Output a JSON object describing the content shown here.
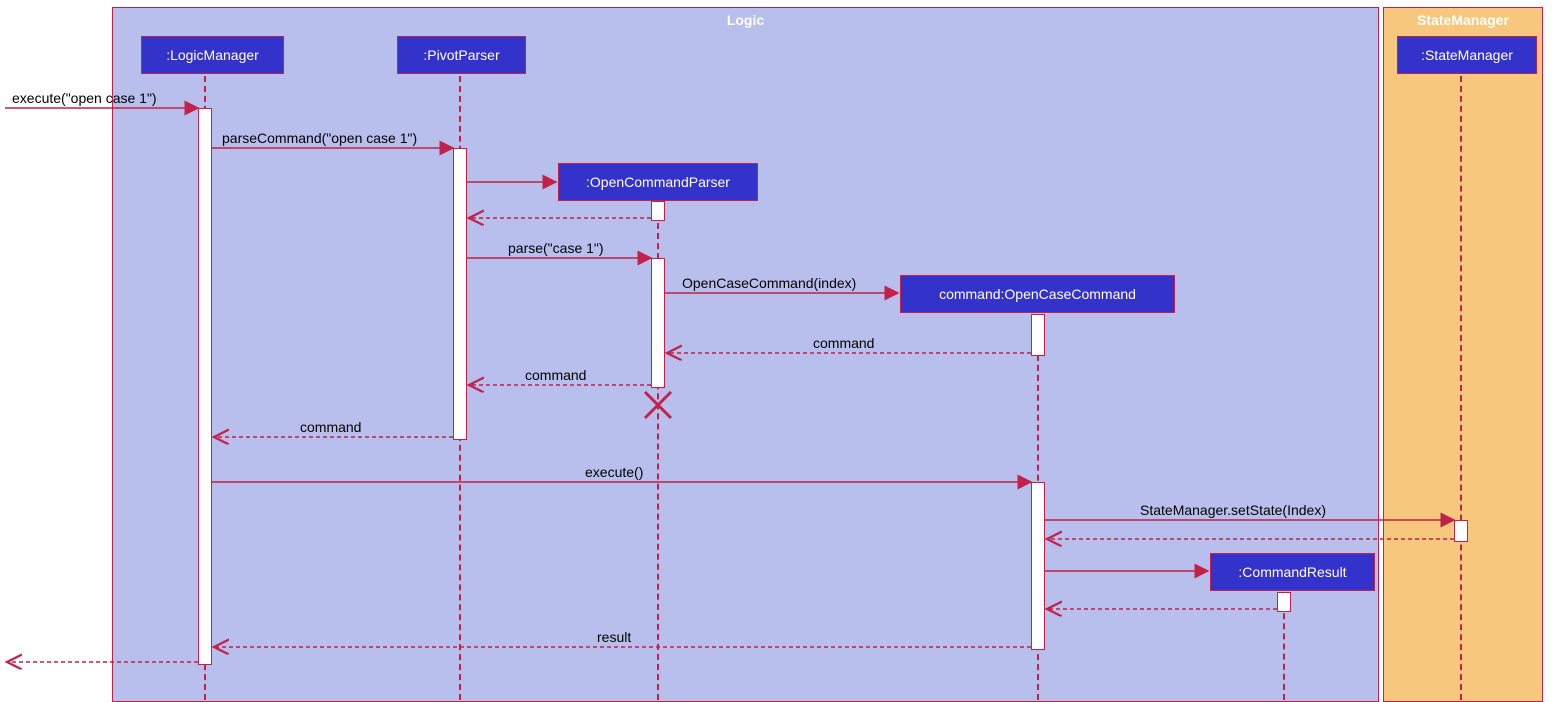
{
  "boxes": {
    "logic": "Logic",
    "state": "StateManager"
  },
  "participants": {
    "logicManager": ":LogicManager",
    "pivotParser": ":PivotParser",
    "openCommandParser": ":OpenCommandParser",
    "openCaseCommand": "command:OpenCaseCommand",
    "stateManager": ":StateManager",
    "commandResult": ":CommandResult"
  },
  "messages": {
    "m1": "execute(\"open case 1\")",
    "m2": "parseCommand(\"open case 1\")",
    "m3": "parse(\"case 1\")",
    "m4": "OpenCaseCommand(index)",
    "m5": "command",
    "m6": "command",
    "m7": "command",
    "m8": "execute()",
    "m9": "StateManager.setState(Index)",
    "m10": "result"
  },
  "diagram_data": {
    "type": "sequence",
    "boxes": [
      {
        "name": "Logic",
        "participants": [
          "LogicManager",
          "PivotParser",
          "OpenCommandParser",
          "OpenCaseCommand",
          "CommandResult"
        ]
      },
      {
        "name": "StateManager",
        "participants": [
          "StateManager"
        ]
      }
    ],
    "sequence": [
      {
        "from": "external",
        "to": "LogicManager",
        "msg": "execute(\"open case 1\")",
        "type": "call"
      },
      {
        "from": "LogicManager",
        "to": "PivotParser",
        "msg": "parseCommand(\"open case 1\")",
        "type": "call"
      },
      {
        "from": "PivotParser",
        "to": "OpenCommandParser",
        "msg": "create",
        "type": "create"
      },
      {
        "from": "OpenCommandParser",
        "to": "PivotParser",
        "msg": "",
        "type": "return"
      },
      {
        "from": "PivotParser",
        "to": "OpenCommandParser",
        "msg": "parse(\"case 1\")",
        "type": "call"
      },
      {
        "from": "OpenCommandParser",
        "to": "OpenCaseCommand",
        "msg": "OpenCaseCommand(index)",
        "type": "create"
      },
      {
        "from": "OpenCaseCommand",
        "to": "OpenCommandParser",
        "msg": "command",
        "type": "return"
      },
      {
        "from": "OpenCommandParser",
        "to": "PivotParser",
        "msg": "command",
        "type": "return"
      },
      {
        "from": "OpenCommandParser",
        "to": null,
        "msg": "",
        "type": "destroy"
      },
      {
        "from": "PivotParser",
        "to": "LogicManager",
        "msg": "command",
        "type": "return"
      },
      {
        "from": "LogicManager",
        "to": "OpenCaseCommand",
        "msg": "execute()",
        "type": "call"
      },
      {
        "from": "OpenCaseCommand",
        "to": "StateManager",
        "msg": "StateManager.setState(Index)",
        "type": "call"
      },
      {
        "from": "StateManager",
        "to": "OpenCaseCommand",
        "msg": "",
        "type": "return"
      },
      {
        "from": "OpenCaseCommand",
        "to": "CommandResult",
        "msg": "create",
        "type": "create"
      },
      {
        "from": "CommandResult",
        "to": "OpenCaseCommand",
        "msg": "",
        "type": "return"
      },
      {
        "from": "OpenCaseCommand",
        "to": "LogicManager",
        "msg": "result",
        "type": "return"
      },
      {
        "from": "LogicManager",
        "to": "external",
        "msg": "",
        "type": "return"
      }
    ]
  }
}
